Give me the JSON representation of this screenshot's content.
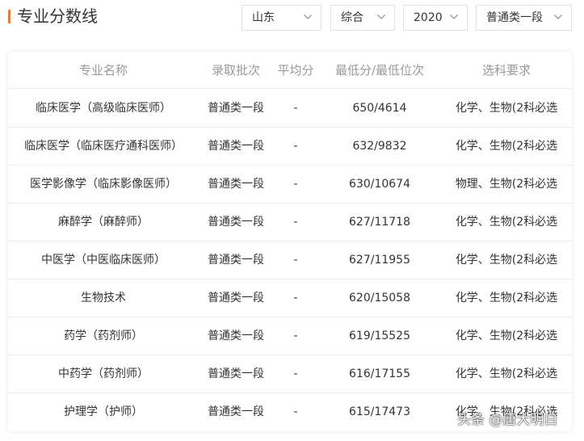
{
  "header": {
    "title": "专业分数线",
    "filters": [
      {
        "name": "province",
        "value": "山东"
      },
      {
        "name": "category",
        "value": "综合"
      },
      {
        "name": "year",
        "value": "2020"
      },
      {
        "name": "batch",
        "value": "普通类一段"
      }
    ]
  },
  "table": {
    "columns": [
      "专业名称",
      "录取批次",
      "平均分",
      "最低分/最低位次",
      "选科要求"
    ],
    "rows": [
      {
        "major": "临床医学（高级临床医师）",
        "batch": "普通类一段",
        "avg": "-",
        "min": "650/4614",
        "req": "化学、生物(2科必选"
      },
      {
        "major": "临床医学（临床医疗通科医师）",
        "batch": "普通类一段",
        "avg": "-",
        "min": "632/9832",
        "req": "化学、生物(2科必选"
      },
      {
        "major": "医学影像学（临床影像医师）",
        "batch": "普通类一段",
        "avg": "-",
        "min": "630/10674",
        "req": "物理、生物(2科必选"
      },
      {
        "major": "麻醉学（麻醉师）",
        "batch": "普通类一段",
        "avg": "-",
        "min": "627/11718",
        "req": "化学、生物(2科必选"
      },
      {
        "major": "中医学（中医临床医师）",
        "batch": "普通类一段",
        "avg": "-",
        "min": "627/11955",
        "req": "化学、生物(2科必选"
      },
      {
        "major": "生物技术",
        "batch": "普通类一段",
        "avg": "-",
        "min": "620/15058",
        "req": "化学、生物(2科必选"
      },
      {
        "major": "药学（药剂师）",
        "batch": "普通类一段",
        "avg": "-",
        "min": "619/15525",
        "req": "化学、生物(2科必选"
      },
      {
        "major": "中药学（药剂师）",
        "batch": "普通类一段",
        "avg": "-",
        "min": "616/17155",
        "req": "化学、生物(2科必选"
      },
      {
        "major": "护理学（护师）",
        "batch": "普通类一段",
        "avg": "-",
        "min": "615/17473",
        "req": "化学、生物(2科必选"
      }
    ]
  },
  "watermark": "头条 @唐大明白",
  "colors": {
    "accent": "#f07b22",
    "header_text": "#999999",
    "body_text": "#333333",
    "divider": "#ececec"
  },
  "icons": {
    "dropdown": "chevron-down-icon"
  }
}
